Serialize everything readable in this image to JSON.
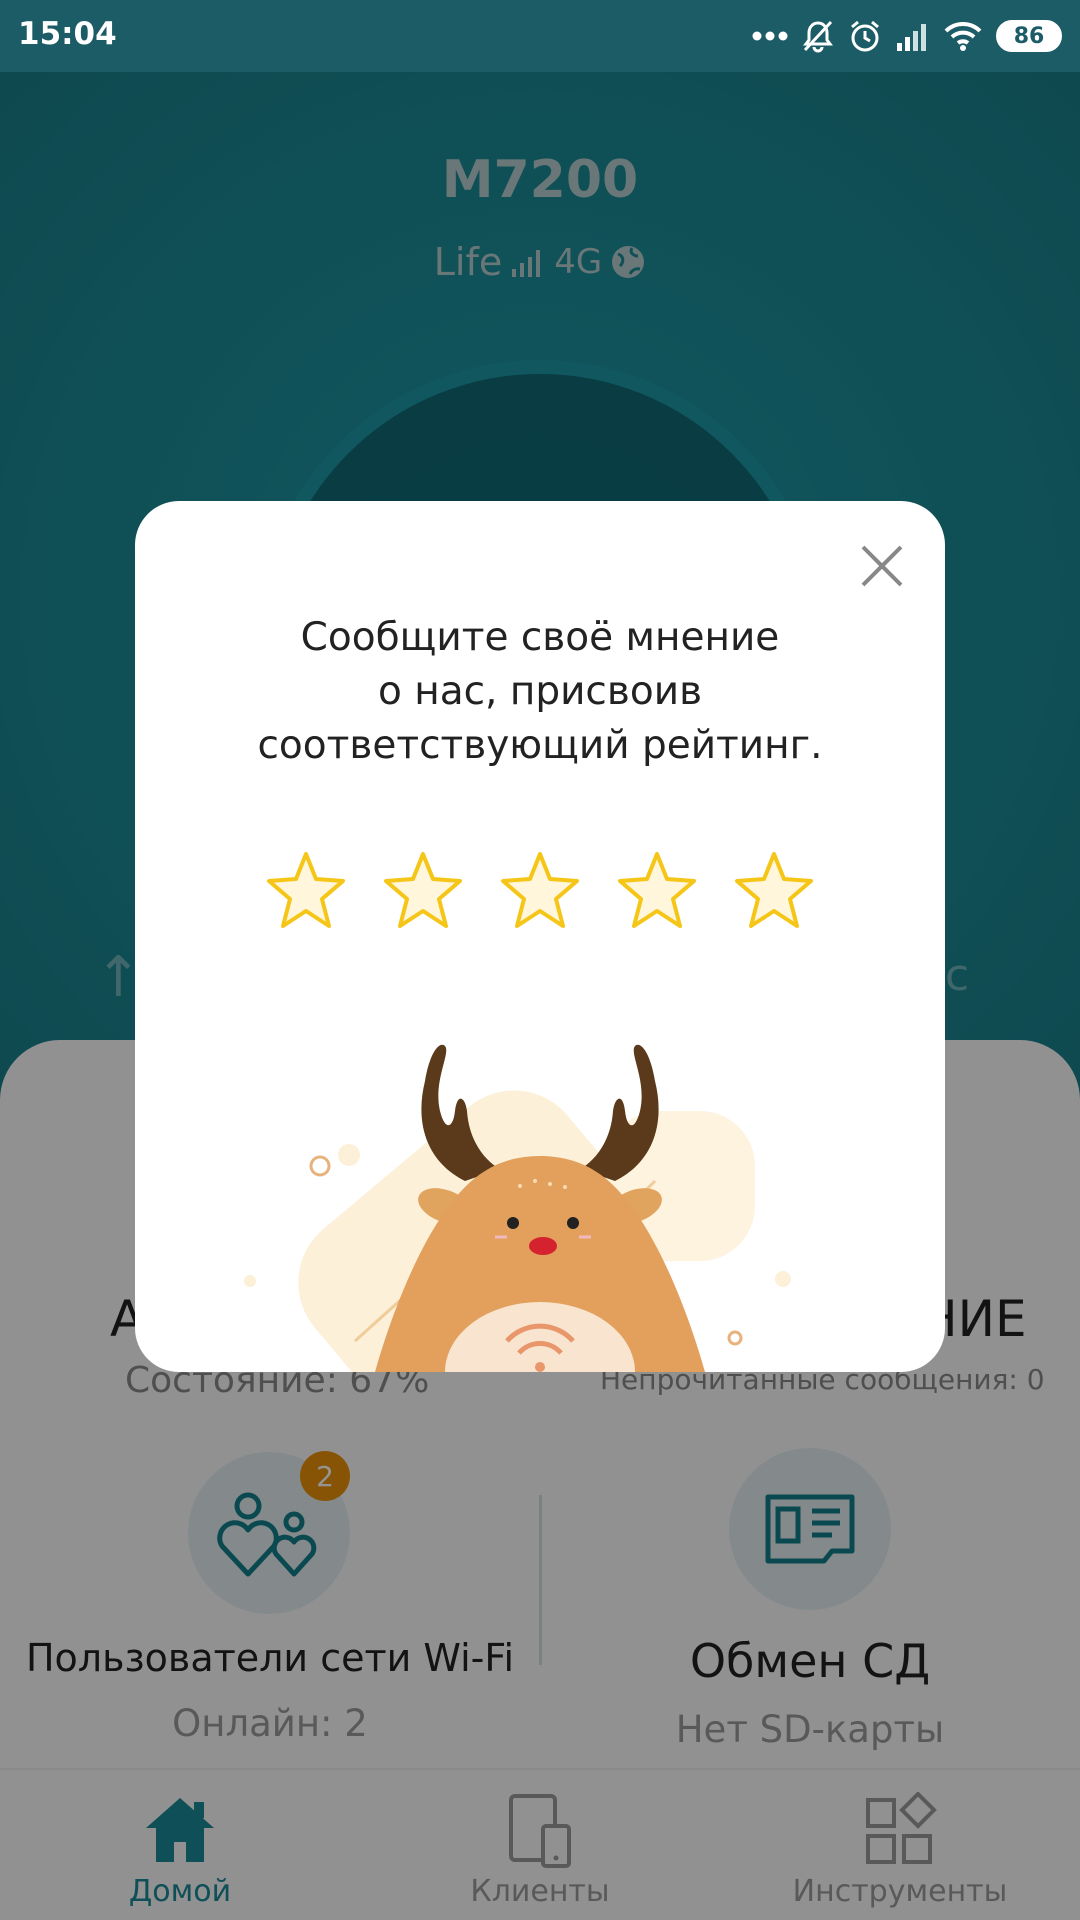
{
  "status_bar": {
    "time": "15:04",
    "battery": "86"
  },
  "device": {
    "name": "M7200",
    "carrier": "Life",
    "network": "4G"
  },
  "speed": {
    "unit_fragment": "/с"
  },
  "cards": {
    "battery_title_fragment": "А",
    "battery_status": "Состояние: 67%",
    "messages_title_fragment": "НИЕ",
    "messages_status": "Непрочитанные сообщения: 0"
  },
  "tiles": [
    {
      "label": "Пользователи сети Wi-Fi",
      "sub": "Онлайн: 2",
      "badge": "2",
      "icon": "users-heart-icon"
    },
    {
      "label": "Обмен СД",
      "sub": "Нет SD-карты",
      "icon": "sd-card-icon"
    }
  ],
  "nav": [
    {
      "label": "Домой",
      "icon": "home-icon",
      "active": true
    },
    {
      "label": "Клиенты",
      "icon": "devices-icon",
      "active": false
    },
    {
      "label": "Инструменты",
      "icon": "tools-grid-icon",
      "active": false
    }
  ],
  "dialog": {
    "line1": "Сообщите своё мнение",
    "line2": "о нас, присвоив",
    "line3": "соответствующий рейтинг.",
    "rating_max": 5,
    "rating_value": 0,
    "close_icon": "close-icon",
    "star_icon": "star-outline-icon",
    "mascot": "deer-mascot-illustration"
  },
  "colors": {
    "status_bar": "#1b5c66",
    "header_teal": "#1b8a95",
    "accent_teal": "#1a8896",
    "badge_orange": "#e8920c",
    "star_outline": "#f5c518",
    "star_fill": "#fff6dc"
  }
}
